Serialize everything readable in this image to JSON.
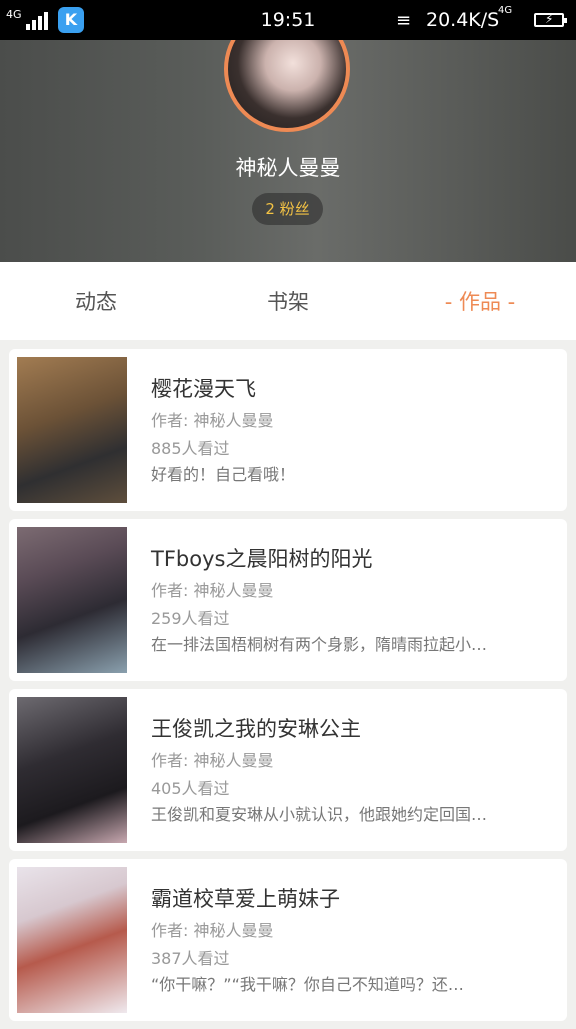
{
  "status_bar": {
    "signal_label": "4G",
    "time": "19:51",
    "network_speed": "20.4K/S",
    "network_type": "4G",
    "app_icon_letter": "K"
  },
  "profile": {
    "username": "神秘人曼曼",
    "fans": "2 粉丝",
    "accent_color": "#ee8a54"
  },
  "tabs": [
    {
      "label": "动态"
    },
    {
      "label": "书架"
    },
    {
      "label": "- 作品 -"
    }
  ],
  "works": [
    {
      "title": "樱花漫天飞",
      "author": "作者: 神秘人曼曼",
      "views": "885人看过",
      "desc": "好看的！自己看哦！"
    },
    {
      "title": "TFboys之晨阳树的阳光",
      "author": "作者: 神秘人曼曼",
      "views": "259人看过",
      "desc": "在一排法国梧桐树有两个身影，隋晴雨拉起小…"
    },
    {
      "title": "王俊凯之我的安琳公主",
      "author": "作者: 神秘人曼曼",
      "views": "405人看过",
      "desc": "王俊凯和夏安琳从小就认识，他跟她约定回国…"
    },
    {
      "title": "霸道校草爱上萌妹子",
      "author": "作者: 神秘人曼曼",
      "views": "387人看过",
      "desc": "“你干嘛？”“我干嘛？你自己不知道吗？还…"
    }
  ]
}
